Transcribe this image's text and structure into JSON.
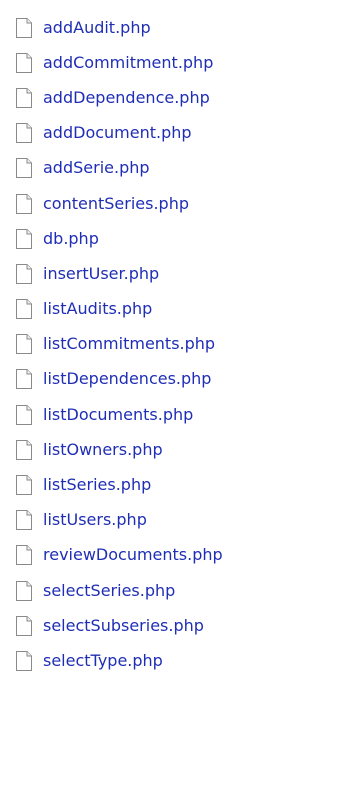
{
  "files": [
    {
      "name": "addAudit.php",
      "icon": "document-icon"
    },
    {
      "name": "addCommitment.php",
      "icon": "document-icon"
    },
    {
      "name": "addDependence.php",
      "icon": "document-icon"
    },
    {
      "name": "addDocument.php",
      "icon": "document-icon"
    },
    {
      "name": "addSerie.php",
      "icon": "document-icon"
    },
    {
      "name": "contentSeries.php",
      "icon": "document-icon"
    },
    {
      "name": "db.php",
      "icon": "document-icon"
    },
    {
      "name": "insertUser.php",
      "icon": "document-icon"
    },
    {
      "name": "listAudits.php",
      "icon": "document-icon"
    },
    {
      "name": "listCommitments.php",
      "icon": "document-icon"
    },
    {
      "name": "listDependences.php",
      "icon": "document-icon"
    },
    {
      "name": "listDocuments.php",
      "icon": "document-icon"
    },
    {
      "name": "listOwners.php",
      "icon": "document-icon"
    },
    {
      "name": "listSeries.php",
      "icon": "document-icon"
    },
    {
      "name": "listUsers.php",
      "icon": "document-icon"
    },
    {
      "name": "reviewDocuments.php",
      "icon": "document-icon"
    },
    {
      "name": "selectSeries.php",
      "icon": "document-icon"
    },
    {
      "name": "selectSubseries.php",
      "icon": "document-icon"
    },
    {
      "name": "selectType.php",
      "icon": "document-icon"
    }
  ],
  "colors": {
    "link": "#1f2eb5"
  }
}
